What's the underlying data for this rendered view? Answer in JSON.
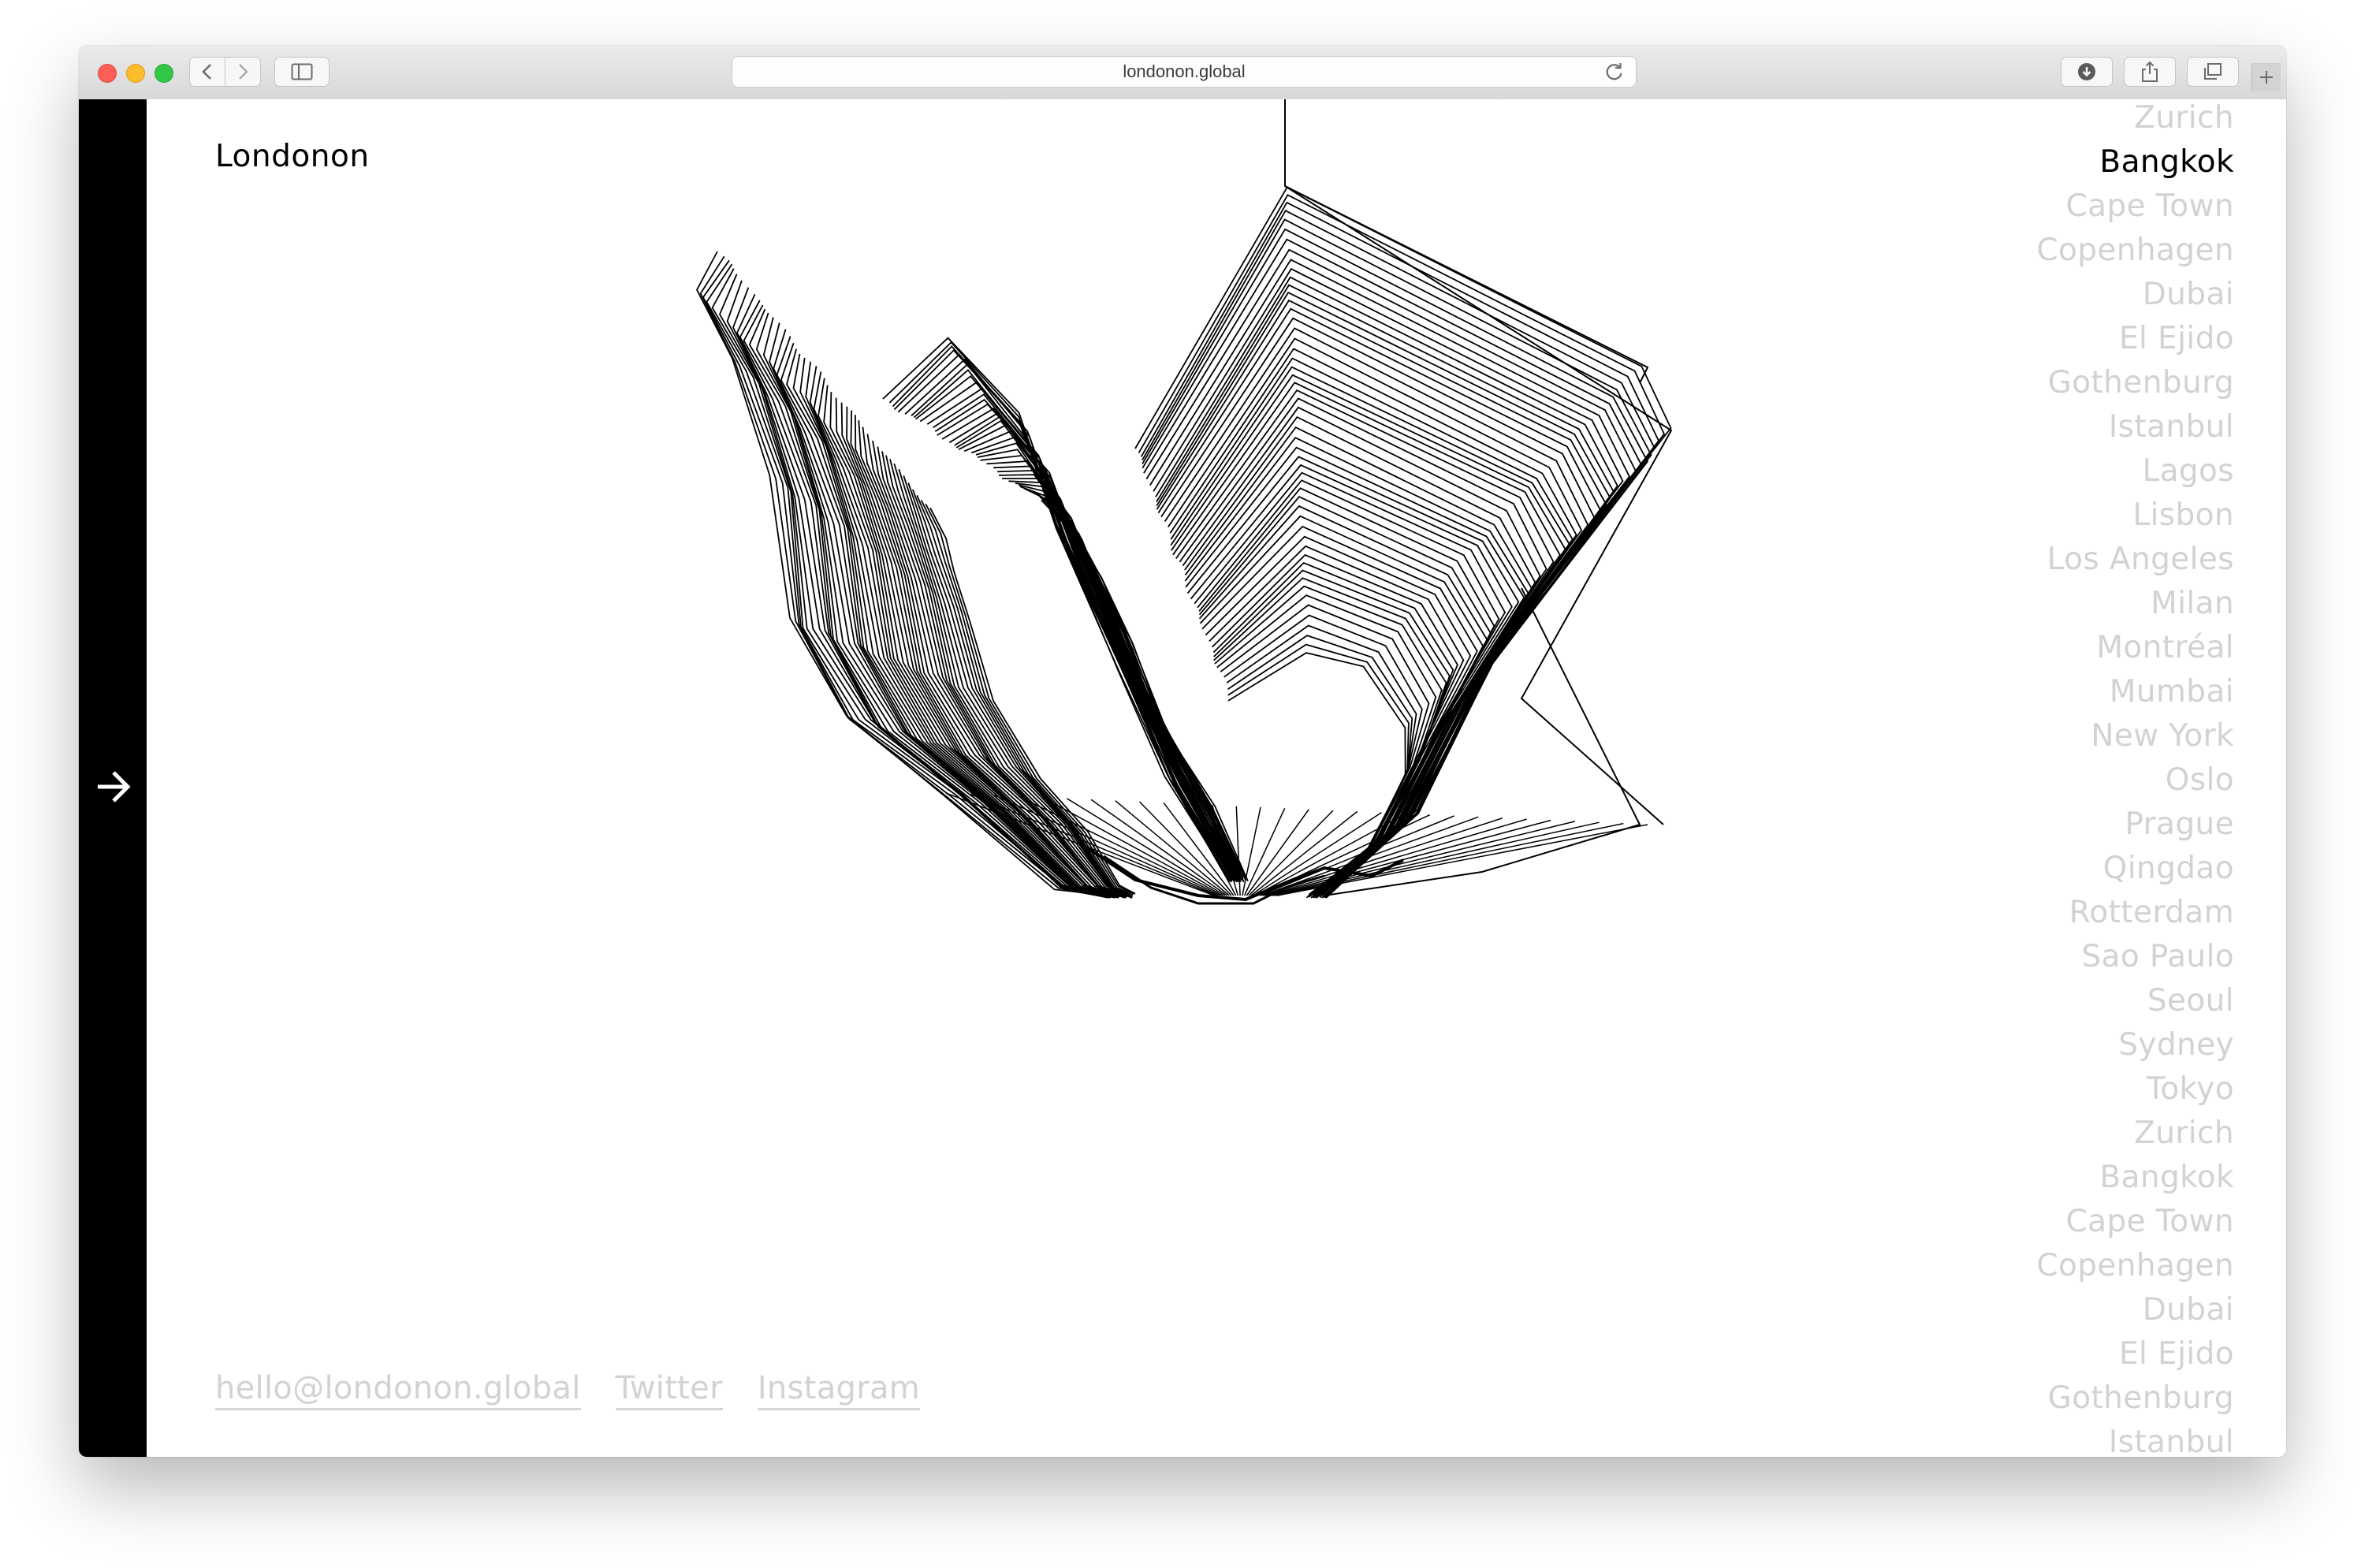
{
  "browser": {
    "url": "londonon.global"
  },
  "site": {
    "brand": "Londonon",
    "footer": {
      "email": "hello@londonon.global",
      "twitter": "Twitter",
      "instagram": "Instagram"
    },
    "cities": [
      {
        "name": "Zurich",
        "active": false
      },
      {
        "name": "Bangkok",
        "active": true
      },
      {
        "name": "Cape Town",
        "active": false
      },
      {
        "name": "Copenhagen",
        "active": false
      },
      {
        "name": "Dubai",
        "active": false
      },
      {
        "name": "El Ejido",
        "active": false
      },
      {
        "name": "Gothenburg",
        "active": false
      },
      {
        "name": "Istanbul",
        "active": false
      },
      {
        "name": "Lagos",
        "active": false
      },
      {
        "name": "Lisbon",
        "active": false
      },
      {
        "name": "Los Angeles",
        "active": false
      },
      {
        "name": "Milan",
        "active": false
      },
      {
        "name": "Montréal",
        "active": false
      },
      {
        "name": "Mumbai",
        "active": false
      },
      {
        "name": "New York",
        "active": false
      },
      {
        "name": "Oslo",
        "active": false
      },
      {
        "name": "Prague",
        "active": false
      },
      {
        "name": "Qingdao",
        "active": false
      },
      {
        "name": "Rotterdam",
        "active": false
      },
      {
        "name": "Sao Paulo",
        "active": false
      },
      {
        "name": "Seoul",
        "active": false
      },
      {
        "name": "Sydney",
        "active": false
      },
      {
        "name": "Tokyo",
        "active": false
      },
      {
        "name": "Zurich",
        "active": false
      },
      {
        "name": "Bangkok",
        "active": false
      },
      {
        "name": "Cape Town",
        "active": false
      },
      {
        "name": "Copenhagen",
        "active": false
      },
      {
        "name": "Dubai",
        "active": false
      },
      {
        "name": "El Ejido",
        "active": false
      },
      {
        "name": "Gothenburg",
        "active": false
      },
      {
        "name": "Istanbul",
        "active": false
      }
    ],
    "colors": {
      "text_active": "#000000",
      "text_inactive": "#d2d2d2",
      "strip": "#000000"
    },
    "icons": {
      "side_arrow": "arrow-right-icon"
    }
  }
}
